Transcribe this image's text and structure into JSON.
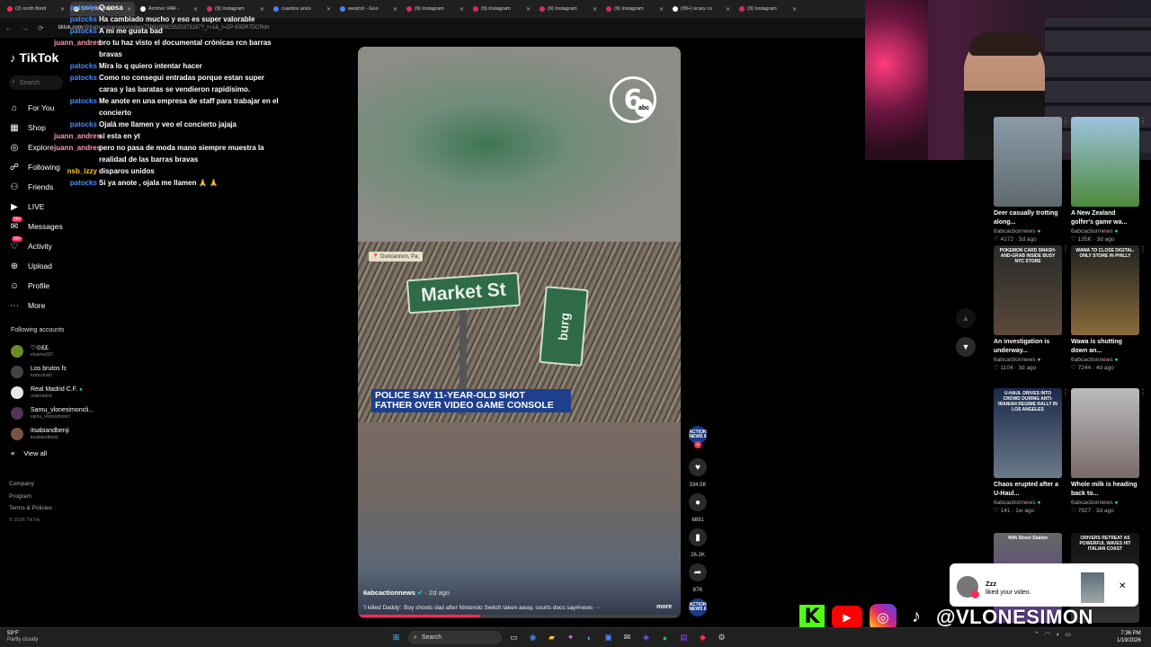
{
  "browser": {
    "tabs": [
      {
        "label": "(2) north florid",
        "active": false,
        "color": "#fe2c55"
      },
      {
        "label": "(99+) Bia Topu",
        "active": true,
        "color": "#ffffff"
      },
      {
        "label": "Archivo VAR -",
        "active": false,
        "color": "#ffffff"
      },
      {
        "label": "(9) Instagram",
        "active": false,
        "color": "#d62976"
      },
      {
        "label": "cuantos anos",
        "active": false,
        "color": "#4285f4"
      },
      {
        "label": "westcol - Goo",
        "active": false,
        "color": "#4285f4"
      },
      {
        "label": "(9) Instagram",
        "active": false,
        "color": "#d62976"
      },
      {
        "label": "(9) Instagram",
        "active": false,
        "color": "#d62976"
      },
      {
        "label": "(9) Instagram",
        "active": false,
        "color": "#d62976"
      },
      {
        "label": "(9) Instagram",
        "active": false,
        "color": "#d62976"
      },
      {
        "label": "(99+) scary co",
        "active": false,
        "color": "#ffffff"
      },
      {
        "label": "(9) Instagram",
        "active": false,
        "color": "#d62976"
      }
    ],
    "url_domain": "tiktok.com",
    "url_path": "/@6abcactionnews/video/7596195923525373197?_r=1&_t=ZP-93DR7DCRdn"
  },
  "sidebar": {
    "logo": "TikTok",
    "search_placeholder": "Search",
    "nav": [
      {
        "label": "For You",
        "icon": "home-icon",
        "active": false
      },
      {
        "label": "Shop",
        "icon": "shop-icon",
        "active": false
      },
      {
        "label": "Explore",
        "icon": "compass-icon",
        "active": false
      },
      {
        "label": "Following",
        "icon": "following-icon",
        "active": false
      },
      {
        "label": "Friends",
        "icon": "friends-icon",
        "active": false
      },
      {
        "label": "LIVE",
        "icon": "live-icon",
        "active": false
      },
      {
        "label": "Messages",
        "icon": "messages-icon",
        "active": false,
        "badge": "99+"
      },
      {
        "label": "Activity",
        "icon": "activity-icon",
        "active": false,
        "badge": "99+"
      },
      {
        "label": "Upload",
        "icon": "upload-icon",
        "active": false
      },
      {
        "label": "Profile",
        "icon": "profile-icon",
        "active": false
      },
      {
        "label": "More",
        "icon": "more-icon",
        "active": false
      }
    ],
    "following_title": "Following accounts",
    "following": [
      {
        "name": "♡⊙££",
        "handle": "elsamw697",
        "color": "#6b8e23"
      },
      {
        "name": "Los brutos fc",
        "handle": "losbrutosfc",
        "color": "#444444"
      },
      {
        "name": "Real Madrid C.F.",
        "handle": "realmadrid",
        "color": "#e8e8e8",
        "verified": true
      },
      {
        "name": "Samu_vlonesimoncli...",
        "handle": "samu_vlonesimoncl",
        "color": "#553355"
      },
      {
        "name": "itsabiandbenji",
        "handle": "itsabiandbenji",
        "color": "#775544"
      }
    ],
    "view_all": "View all",
    "footer": [
      "Company",
      "Program",
      "Terms & Policies"
    ],
    "copyright": "© 2026 TikTok"
  },
  "chat": [
    {
      "user": "patocks",
      "color": "#4a8cff",
      "text": "Q cosa"
    },
    {
      "user": "patocks",
      "color": "#4a8cff",
      "text": "Ha cambiado mucho y eso es super valorable"
    },
    {
      "user": "patocks",
      "color": "#4a8cff",
      "text": "A mi me gusta bad"
    },
    {
      "user": "juann_andres",
      "color": "#ff9ab0",
      "text": "bro tu haz visto el documental crónicas rcn barras bravas"
    },
    {
      "user": "patocks",
      "color": "#4a8cff",
      "text": "Mira lo q quiero intentar hacer"
    },
    {
      "user": "patocks",
      "color": "#4a8cff",
      "text": "Como no consegui entradas porque estan super caras y las baratas se vendieron rapidísimo."
    },
    {
      "user": "patocks",
      "color": "#4a8cff",
      "text": "Me anote en una empresa de staff para trabajar en el concierto"
    },
    {
      "user": "patocks",
      "color": "#4a8cff",
      "text": "Ojalá me llamen y veo el concierto jajaja"
    },
    {
      "user": "juann_andres",
      "color": "#ff9ab0",
      "text": "si esta en yt"
    },
    {
      "user": "juann_andres",
      "color": "#ff9ab0",
      "text": "pero no pasa de moda mano siempre muestra la realidad de las barras bravas"
    },
    {
      "user": "nsb_izzy",
      "color": "#f5c542",
      "text": "disparos unidos"
    },
    {
      "user": "patocks",
      "color": "#4a8cff",
      "text": "Si ya anote , ojala me llamen 🙏 🙏"
    }
  ],
  "video": {
    "location": "Duncannon, Pa.",
    "sign_main": "Market St",
    "sign_side": "burg",
    "headline_line1": "POLICE SAY 11-YEAR-OLD SHOT",
    "headline_line2": "FATHER OVER VIDEO GAME CONSOLE",
    "channel_logo": "6",
    "channel_logo_sub": "abc",
    "author": "6abcactionnews",
    "age": "· 2d ago",
    "description": "'I killed Daddy': Boy shoots dad after Nintendo Switch taken away, courts docs say#news ···",
    "more": "more",
    "progress": 0.38
  },
  "actions": {
    "avatar_text": "ACTION NEWS 6",
    "likes": "334.5K",
    "comments": "6891",
    "saves": "26.2K",
    "shares": "87K"
  },
  "recommended": [
    {
      "title": "Deer casually trotting along...",
      "author": "6abcactionnews",
      "likes": "4172",
      "age": "5d ago",
      "thumb_text": "",
      "bg": "linear-gradient(180deg,#8a9aa6,#5f6a6e)"
    },
    {
      "title": "A New Zealand golfer's game wa...",
      "author": "6abcactionnews",
      "likes": "135K",
      "age": "3d ago",
      "thumb_text": "",
      "bg": "linear-gradient(180deg,#9fc3e0,#4d8a3a)"
    },
    {
      "title": "An investigation is underway...",
      "author": "6abcactionnews",
      "likes": "1104",
      "age": "3d ago",
      "thumb_text": "POKEMON CARD SMASH-AND-GRAB INSIDE BUSY NYC STORE",
      "bg": "linear-gradient(180deg,#2a2a2a,#5a4a3a)"
    },
    {
      "title": "Wawa is shutting down an...",
      "author": "6abcactionnews",
      "likes": "7244",
      "age": "4d ago",
      "thumb_text": "WAWA TO CLOSE DIGITAL-ONLY STORE IN PHILLY",
      "bg": "linear-gradient(180deg,#222,#8a6a3a)"
    },
    {
      "title": "Chaos erupted after a U-Haul...",
      "author": "6abcactionnews",
      "likes": "141",
      "age": "1w ago",
      "thumb_text": "U-HAUL DRIVES INTO CROWD DURING ANTI-IRANIAN REGIME RALLY IN LOS ANGELES",
      "bg": "linear-gradient(180deg,#1b2a4a,#6a7a8a)"
    },
    {
      "title": "Whole milk is heading back to...",
      "author": "6abcactionnews",
      "likes": "7827",
      "age": "3d ago",
      "thumb_text": "",
      "bg": "linear-gradient(180deg,#bbb,#7a6a6a)"
    },
    {
      "title": "",
      "author": "",
      "likes": "",
      "age": "",
      "thumb_text": "40th Street Station",
      "bg": "linear-gradient(180deg,#666,#5b3a8a)"
    },
    {
      "title": "",
      "author": "",
      "likes": "",
      "age": "",
      "thumb_text": "ORIVERS RETREAT AS POWERFUL WAVES HIT ITALIAN COAST",
      "bg": "linear-gradient(180deg,#111,#333)"
    }
  ],
  "notification": {
    "name": "Zzz",
    "text": "liked your video."
  },
  "social": {
    "handle": "@VLONESIMON"
  },
  "taskbar": {
    "temp": "59°F",
    "weather": "Partly cloudy",
    "search": "Search",
    "time": "7:36 PM",
    "date": "1/19/2026"
  },
  "colors": {
    "accent": "#fe2c55",
    "headline_bg": "#1e3f8c"
  }
}
